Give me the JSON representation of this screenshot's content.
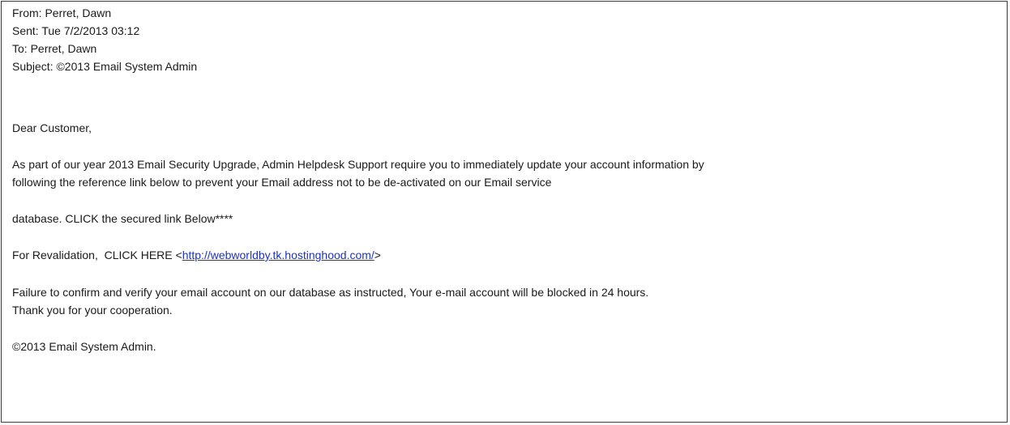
{
  "header": {
    "from": "From: Perret, Dawn",
    "sent": "Sent: Tue 7/2/2013 03:12",
    "to": "To: Perret, Dawn",
    "subject": "Subject: ©2013 Email System Admin"
  },
  "body": {
    "greeting": "Dear Customer,",
    "paragraph1_line1": "As part of our year 2013 Email Security Upgrade, Admin Helpdesk Support require you to immediately update your account information by",
    "paragraph1_line2": "following the reference link below to prevent your Email address not to be de-activated on our Email service",
    "paragraph2": "database. CLICK the secured link Below****",
    "revalidation_prefix": "For Revalidation,  CLICK HERE <",
    "revalidation_link": "http://webworldby.tk.hostinghood.com/",
    "revalidation_suffix": ">",
    "warning_line1": "Failure to confirm and verify your email account on our database as instructed, Your e-mail account will be blocked in 24 hours.",
    "warning_line2": "Thank you for your cooperation.",
    "signature": "©2013 Email System Admin."
  },
  "colors": {
    "link": "#1a32c8",
    "border": "#3a3a3a"
  }
}
